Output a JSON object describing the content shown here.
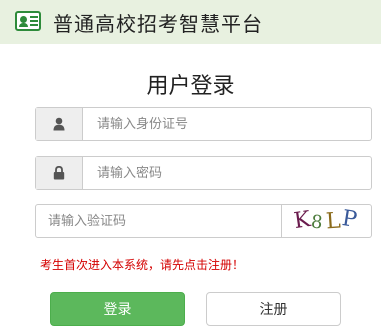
{
  "header": {
    "title": "普通高校招考智慧平台",
    "logo_icon": "id-card-icon",
    "background": "#e8f1e0"
  },
  "login": {
    "title": "用户登录",
    "id_field": {
      "placeholder": "请输入身份证号",
      "value": "",
      "icon": "user-icon"
    },
    "password_field": {
      "placeholder": "请输入密码",
      "value": "",
      "icon": "lock-icon"
    },
    "captcha_field": {
      "placeholder": "请输入验证码",
      "value": ""
    },
    "captcha_image": {
      "characters": [
        "K",
        "8",
        "L",
        "P"
      ]
    },
    "notice": "考生首次进入本系统，请先点击注册！",
    "login_button": "登录",
    "register_button": "注册"
  },
  "colors": {
    "accent": "#5cb85c",
    "notice": "#d40000"
  }
}
